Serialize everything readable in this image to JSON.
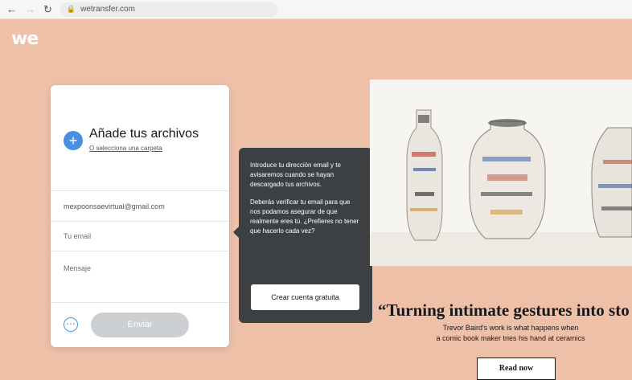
{
  "browser": {
    "back_icon": "arrow-left-icon",
    "forward_icon": "arrow-right-icon",
    "reload_icon": "reload-icon",
    "url": "wetransfer.com"
  },
  "logo": "we",
  "upload": {
    "add_title": "Añade tus archivos",
    "add_folder_link": "O selecciona una carpeta",
    "to_value": "mexpoonsaevirtual@gmail.com",
    "your_email_placeholder": "Tu email",
    "message_placeholder": "Mensaje",
    "send_label": "Enviar",
    "plus_icon": "plus-icon",
    "options_icon": "options-icon"
  },
  "tooltip": {
    "paragraph1": "Introduce tu dirección email y te avisaremos cuando se hayan descargado tus archivos.",
    "paragraph2": "Deberás verificar tu email para que nos podamos asegurar de que realmente eres tú. ¿Prefieres no tener que hacerlo cada vez?",
    "button_label": "Crear cuenta gratuita"
  },
  "ad": {
    "headline": "“Turning intimate gestures into sto",
    "subline1": "Trevor Baird's work is what happens when",
    "subline2": "a comic book maker tries his hand at ceramics",
    "read_button": "Read now"
  },
  "colors": {
    "background": "#eec0a8",
    "accent_blue": "#4a90e2",
    "tooltip_bg": "#3c4043",
    "send_disabled": "#cdd0d3"
  }
}
